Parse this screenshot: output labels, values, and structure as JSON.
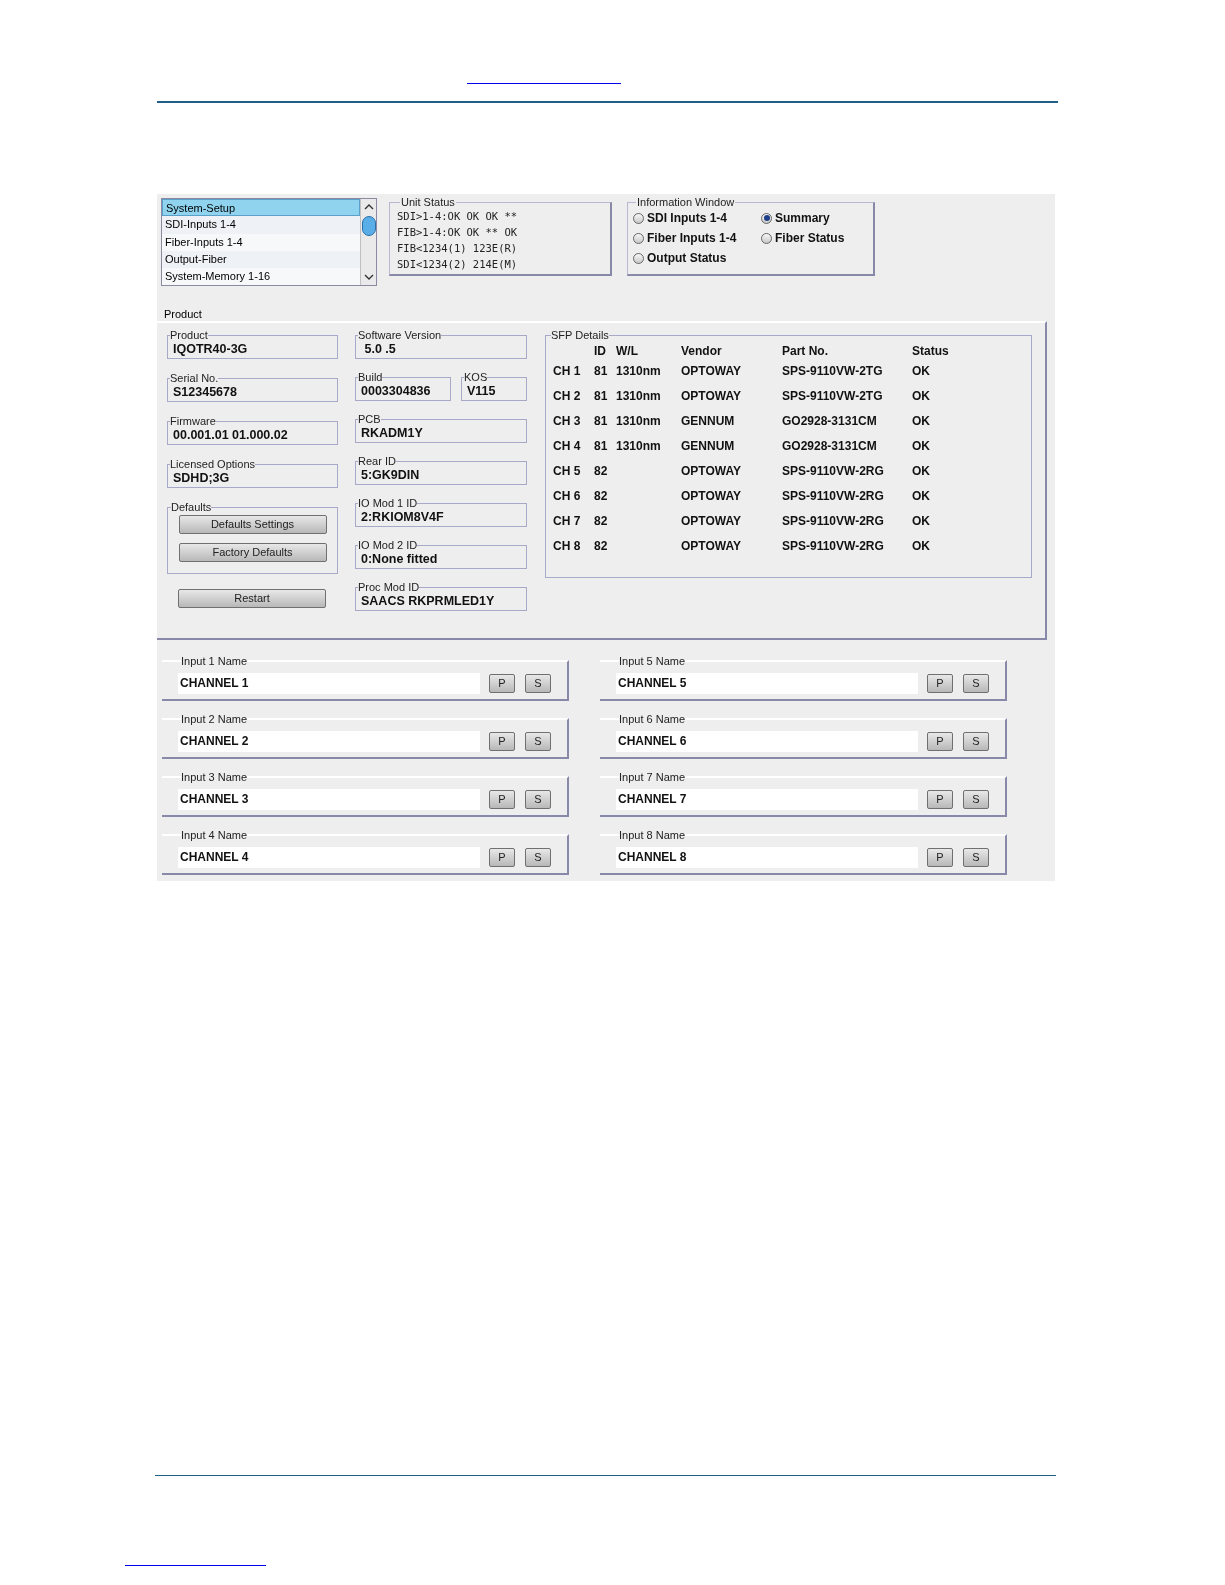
{
  "nav_list": {
    "items": [
      {
        "label": "System-Setup",
        "selected": true
      },
      {
        "label": "SDI-Inputs 1-4",
        "selected": false
      },
      {
        "label": "Fiber-Inputs 1-4",
        "selected": false
      },
      {
        "label": "Output-Fiber",
        "selected": false
      },
      {
        "label": "System-Memory 1-16",
        "selected": false
      }
    ]
  },
  "unit_status": {
    "title": "Unit Status",
    "lines": [
      "SDI>1-4:OK OK OK **",
      "FIB>1-4:OK OK ** OK",
      "FIB<1234(1) 123E(R)",
      "SDI<1234(2) 214E(M)"
    ]
  },
  "information_window": {
    "title": "Information Window",
    "options": [
      {
        "label": "SDI Inputs 1-4",
        "selected": false
      },
      {
        "label": "Summary",
        "selected": true
      },
      {
        "label": "Fiber Inputs 1-4",
        "selected": false
      },
      {
        "label": "Fiber Status",
        "selected": false
      },
      {
        "label": "Output Status",
        "selected": false
      }
    ]
  },
  "product": {
    "title": "Product",
    "fields_left": [
      {
        "label": "Product",
        "value": "IQOTR40-3G"
      },
      {
        "label": "Serial No.",
        "value": "S12345678"
      },
      {
        "label": "Firmware",
        "value": "00.001.01 01.000.02"
      },
      {
        "label": "Licensed Options",
        "value": "SDHD;3G"
      }
    ],
    "defaults": {
      "title": "Defaults",
      "buttons": [
        "Defaults Settings",
        "Factory Defaults"
      ]
    },
    "restart_button": "Restart",
    "fields_right": [
      [
        {
          "label": "Software Version",
          "value": " 5.0 .5"
        }
      ],
      [
        {
          "label": "Build",
          "value": "0003304836"
        },
        {
          "label": "KOS",
          "value": "V115"
        }
      ],
      [
        {
          "label": "PCB",
          "value": "RKADM1Y"
        }
      ],
      [
        {
          "label": "Rear ID",
          "value": "5:GK9DIN"
        }
      ],
      [
        {
          "label": "IO Mod 1 ID",
          "value": "2:RKIOM8V4F"
        }
      ],
      [
        {
          "label": "IO Mod 2 ID",
          "value": "0:None fitted"
        }
      ],
      [
        {
          "label": "Proc Mod ID",
          "value": "SAACS RKPRMLED1Y"
        }
      ]
    ],
    "sfp_details": {
      "title": "SFP Details",
      "columns": [
        "",
        "ID",
        "W/L",
        "Vendor",
        "Part No.",
        "Status"
      ],
      "rows": [
        [
          "CH 1",
          "81",
          "1310nm",
          "OPTOWAY",
          "SPS-9110VW-2TG",
          "OK"
        ],
        [
          "CH 2",
          "81",
          "1310nm",
          "OPTOWAY",
          "SPS-9110VW-2TG",
          "OK"
        ],
        [
          "CH 3",
          "81",
          "1310nm",
          "GENNUM",
          "GO2928-3131CM",
          "OK"
        ],
        [
          "CH 4",
          "81",
          "1310nm",
          "GENNUM",
          "GO2928-3131CM",
          "OK"
        ],
        [
          "CH 5",
          "82",
          "",
          "OPTOWAY",
          "SPS-9110VW-2RG",
          "OK"
        ],
        [
          "CH 6",
          "82",
          "",
          "OPTOWAY",
          "SPS-9110VW-2RG",
          "OK"
        ],
        [
          "CH 7",
          "82",
          "",
          "OPTOWAY",
          "SPS-9110VW-2RG",
          "OK"
        ],
        [
          "CH 8",
          "82",
          "",
          "OPTOWAY",
          "SPS-9110VW-2RG",
          "OK"
        ]
      ]
    }
  },
  "inputs": [
    {
      "label": "Input 1 Name",
      "value": "CHANNEL 1",
      "buttons": [
        "P",
        "S"
      ]
    },
    {
      "label": "Input 5 Name",
      "value": "CHANNEL 5",
      "buttons": [
        "P",
        "S"
      ]
    },
    {
      "label": "Input 2 Name",
      "value": "CHANNEL 2",
      "buttons": [
        "P",
        "S"
      ]
    },
    {
      "label": "Input 6 Name",
      "value": "CHANNEL 6",
      "buttons": [
        "P",
        "S"
      ]
    },
    {
      "label": "Input 3 Name",
      "value": "CHANNEL 3",
      "buttons": [
        "P",
        "S"
      ]
    },
    {
      "label": "Input 7 Name",
      "value": "CHANNEL 7",
      "buttons": [
        "P",
        "S"
      ]
    },
    {
      "label": "Input 4 Name",
      "value": "CHANNEL 4",
      "buttons": [
        "P",
        "S"
      ]
    },
    {
      "label": "Input 8 Name",
      "value": "CHANNEL 8",
      "buttons": [
        "P",
        "S"
      ]
    }
  ]
}
